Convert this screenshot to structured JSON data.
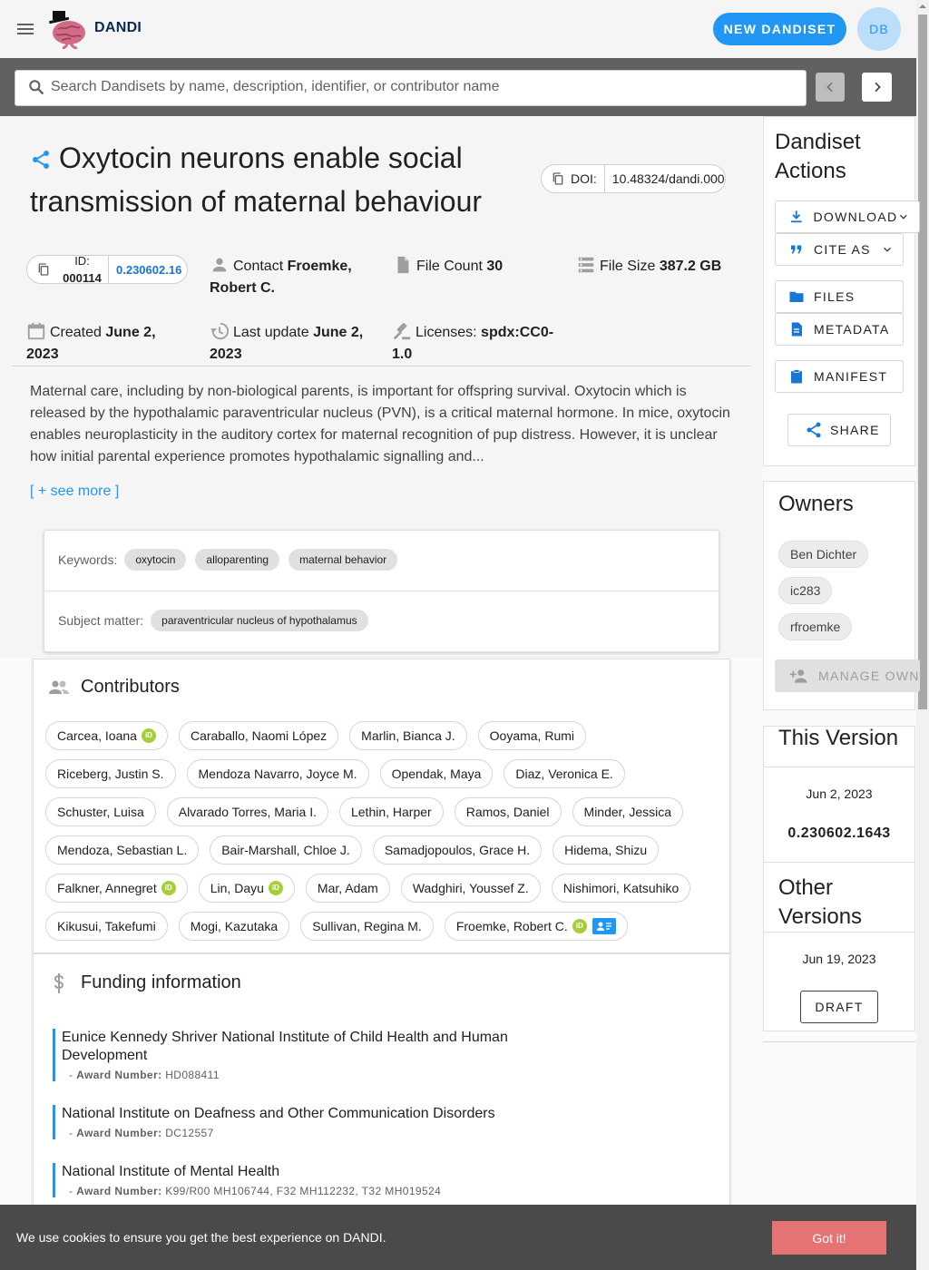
{
  "app": {
    "brand": "DANDI",
    "new_dandiset_label": "New Dandiset",
    "avatar_initials": "DB"
  },
  "search": {
    "placeholder": "Search Dandisets by name, description, identifier, or contributor name",
    "value": ""
  },
  "dandiset": {
    "title": "Oxytocin neurons enable social transmission of maternal behaviour",
    "doi_label": "DOI:",
    "doi_value": "10.48324/dandi.000",
    "id_label": "ID:",
    "id_value": "000114",
    "id_version": "0.230602.16",
    "contact_label": "Contact",
    "contact_value": "Froemke, Robert C.",
    "file_count_label": "File Count",
    "file_count_value": "30",
    "file_size_label": "File Size",
    "file_size_value": "387.2 GB",
    "created_label": "Created",
    "created_value": "June 2, 2023",
    "last_update_label": "Last update",
    "last_update_value": "June 2, 2023",
    "licenses_label": "Licenses:",
    "licenses_value": "spdx:CC0-1.0",
    "description": "Maternal care, including by non-biological parents, is important for offspring survival. Oxytocin which is released by the hypothalamic paraventricular nucleus (PVN), is a critical maternal hormone. In mice, oxytocin enables neuroplasticity in the auditory cortex for maternal recognition of pup distress. However, it is unclear how initial parental experience promotes hypothalamic signalling and...",
    "see_more": "[ + see more ]",
    "keywords_label": "Keywords:",
    "keywords": [
      "oxytocin",
      "alloparenting",
      "maternal behavior"
    ],
    "subject_label": "Subject matter:",
    "subjects": [
      "paraventricular nucleus of hypothalamus"
    ]
  },
  "contributors": {
    "heading": "Contributors",
    "people": [
      {
        "name": "Carcea, Ioana",
        "orcid": true
      },
      {
        "name": "Caraballo, Naomi López"
      },
      {
        "name": "Marlin, Bianca J."
      },
      {
        "name": "Ooyama, Rumi"
      },
      {
        "name": "Riceberg, Justin S."
      },
      {
        "name": "Mendoza Navarro, Joyce M."
      },
      {
        "name": "Opendak, Maya"
      },
      {
        "name": "Diaz, Veronica E."
      },
      {
        "name": "Schuster, Luisa"
      },
      {
        "name": "Alvarado Torres, Maria I."
      },
      {
        "name": "Lethin, Harper"
      },
      {
        "name": "Ramos, Daniel"
      },
      {
        "name": "Minder, Jessica"
      },
      {
        "name": "Mendoza, Sebastian L."
      },
      {
        "name": "Bair-Marshall, Chloe J."
      },
      {
        "name": "Samadjopoulos, Grace H."
      },
      {
        "name": "Hidema, Shizu"
      },
      {
        "name": "Falkner, Annegret",
        "orcid": true
      },
      {
        "name": "Lin, Dayu",
        "orcid": true
      },
      {
        "name": "Mar, Adam"
      },
      {
        "name": "Wadghiri, Youssef Z."
      },
      {
        "name": "Nishimori, Katsuhiko"
      },
      {
        "name": "Kikusui, Takefumi"
      },
      {
        "name": "Mogi, Kazutaka"
      },
      {
        "name": "Sullivan, Regina M."
      },
      {
        "name": "Froemke, Robert C.",
        "orcid": true,
        "contact": true
      }
    ],
    "orcid_glyph": "iD"
  },
  "funding": {
    "heading": "Funding information",
    "award_label": "Award Number:",
    "items": [
      {
        "name": "Eunice Kennedy Shriver National Institute of Child Health and Human Development",
        "award": "HD088411"
      },
      {
        "name": "National Institute on Deafness and Other Communication Disorders",
        "award": "DC12557"
      },
      {
        "name": "National Institute of Mental Health",
        "award": "K99/R00 MH106744, F32 MH112232, T32 MH019524"
      }
    ]
  },
  "sidebar": {
    "actions_title": "Dandiset Actions",
    "download": "Download",
    "cite_as": "Cite As",
    "files": "Files",
    "metadata": "Metadata",
    "manifest": "Manifest",
    "share": "Share",
    "owners_title": "Owners",
    "owners": [
      "Ben Dichter",
      "ic283",
      "rfroemke"
    ],
    "manage_owners": "Manage Own",
    "this_version_title": "This Version",
    "this_version_date": "Jun 2, 2023",
    "this_version_number": "0.230602.1643",
    "other_versions_title": "Other Versions",
    "other_version_date": "Jun 19, 2023",
    "draft_label": "Draft"
  },
  "cookie": {
    "text": "We use cookies to ensure you get the best experience on DANDI.",
    "button": "Got it!"
  },
  "colors": {
    "primary": "#2196f3",
    "app_bar": "#f5f5f5",
    "search_bar": "#616161",
    "cookie_banner": "#4a4a4a",
    "cookie_button": "#e57373",
    "orcid": "#a6ce39"
  },
  "icons": {
    "menu": "menu-icon",
    "search": "search-icon",
    "share": "share-icon",
    "copy": "copy-icon",
    "person": "person-icon",
    "file": "file-icon",
    "storage": "storage-icon",
    "calendar": "calendar-icon",
    "history": "history-icon",
    "license": "gavel-icon",
    "contributors": "people-icon",
    "funding": "dollar-icon"
  }
}
